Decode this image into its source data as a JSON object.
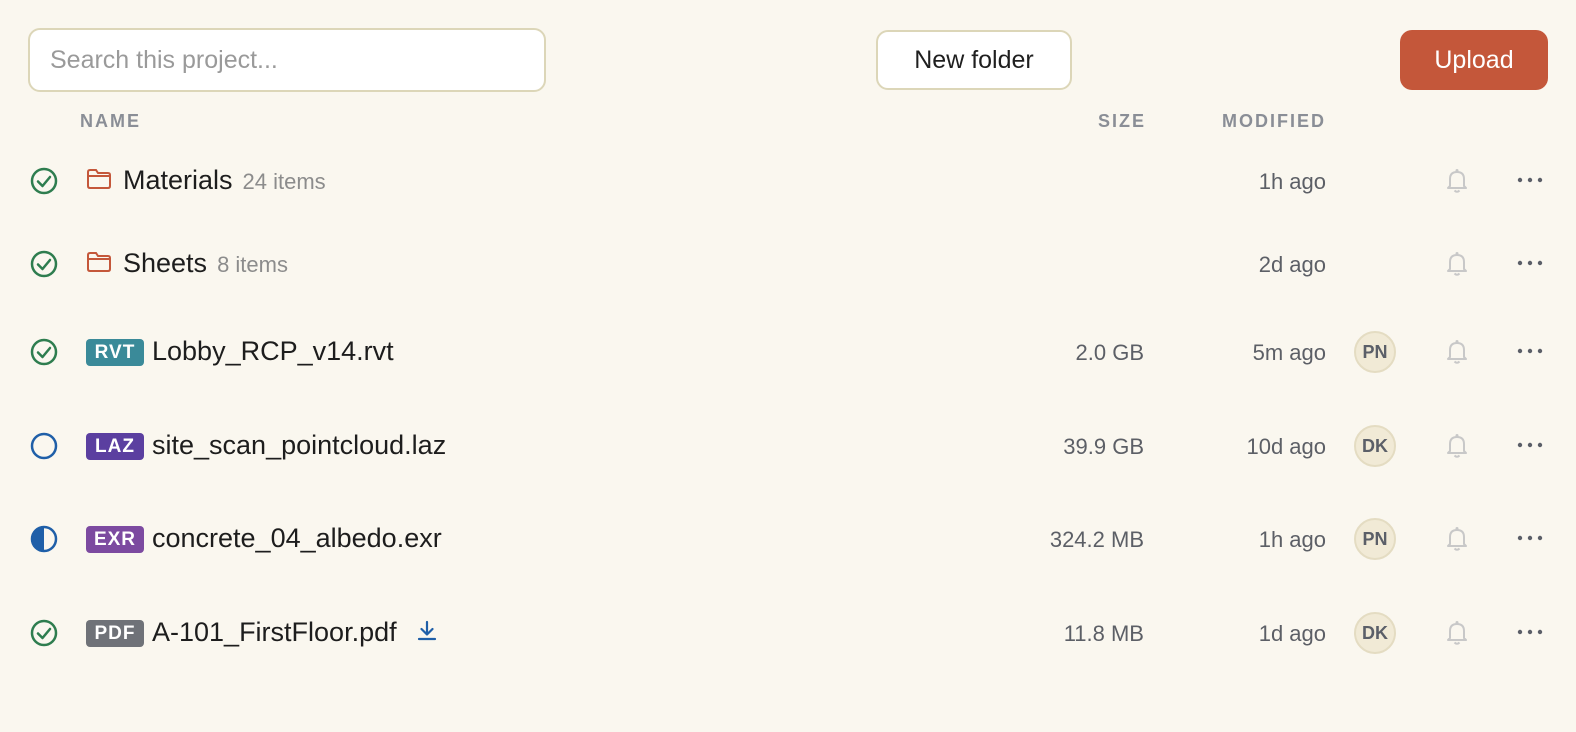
{
  "search": {
    "placeholder": "Search this project..."
  },
  "toolbar": {
    "new_folder_label": "New folder",
    "upload_label": "Upload"
  },
  "columns": {
    "name": "NAME",
    "size": "SIZE",
    "modified": "MODIFIED"
  },
  "colors": {
    "accent": "#c4573a",
    "synced": "#2e7d4f",
    "pending": "#1f5fa8",
    "rvt": "#3a8a99",
    "laz": "#5b3fa0",
    "exr": "#7c4aa0",
    "pdf": "#6f7278"
  },
  "rows": [
    {
      "status": "synced-icon",
      "type": "folder",
      "name": "Materials",
      "count": "24 items",
      "size": "",
      "modified": "1h ago",
      "avatar": ""
    },
    {
      "status": "synced-icon",
      "type": "folder",
      "name": "Sheets",
      "count": "8 items",
      "size": "",
      "modified": "2d ago",
      "avatar": ""
    },
    {
      "status": "synced-icon",
      "type": "file",
      "badge": "RVT",
      "name": "Lobby_RCP_v14.rvt",
      "size": "2.0 GB",
      "modified": "5m ago",
      "avatar": "PN"
    },
    {
      "status": "not-synced-icon",
      "type": "file",
      "badge": "LAZ",
      "name": "site_scan_pointcloud.laz",
      "size": "39.9 GB",
      "modified": "10d ago",
      "avatar": "DK"
    },
    {
      "status": "partial-sync-icon",
      "type": "file",
      "badge": "EXR",
      "name": "concrete_04_albedo.exr",
      "size": "324.2 MB",
      "modified": "1h ago",
      "avatar": "PN"
    },
    {
      "status": "synced-icon",
      "type": "file",
      "badge": "PDF",
      "name": "A-101_FirstFloor.pdf",
      "size": "11.8 MB",
      "modified": "1d ago",
      "avatar": "DK",
      "download_icon": "download-icon"
    }
  ]
}
